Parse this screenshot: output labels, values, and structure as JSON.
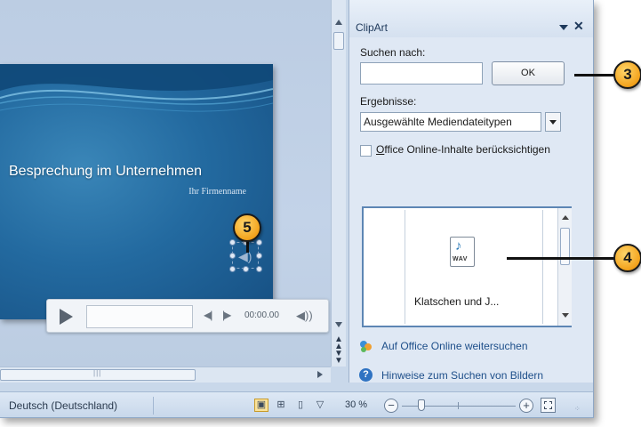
{
  "slide": {
    "title": "Besprechung im Unternehmen",
    "subtitle": "Ihr Firmenname"
  },
  "player": {
    "time": "00:00.00",
    "play_icon": "play-icon",
    "volume_icon": "volume-icon"
  },
  "pane": {
    "title": "ClipArt",
    "search_label": "Suchen nach:",
    "search_value": "",
    "ok_label": "OK",
    "results_label": "Ergebnisse:",
    "results_selected": "Ausgewählte Mediendateitypen",
    "online_checkbox_prefix": "O",
    "online_checkbox_rest": "ffice Online-Inhalte berücksichtigen",
    "online_checked": false,
    "clip_type": "WAV",
    "clip_name": "Klatschen und J...",
    "link_online": "Auf Office Online weitersuchen",
    "link_help": "Hinweise zum Suchen von Bildern"
  },
  "statusbar": {
    "language": "Deutsch (Deutschland)",
    "zoom": "30 %"
  },
  "callouts": {
    "c3": "3",
    "c4": "4",
    "c5": "5"
  },
  "colors": {
    "accent": "#f3a21c",
    "pane_bg": "#dfe8f4",
    "slide_bg": "#236aa0",
    "link": "#1e4f8a"
  }
}
